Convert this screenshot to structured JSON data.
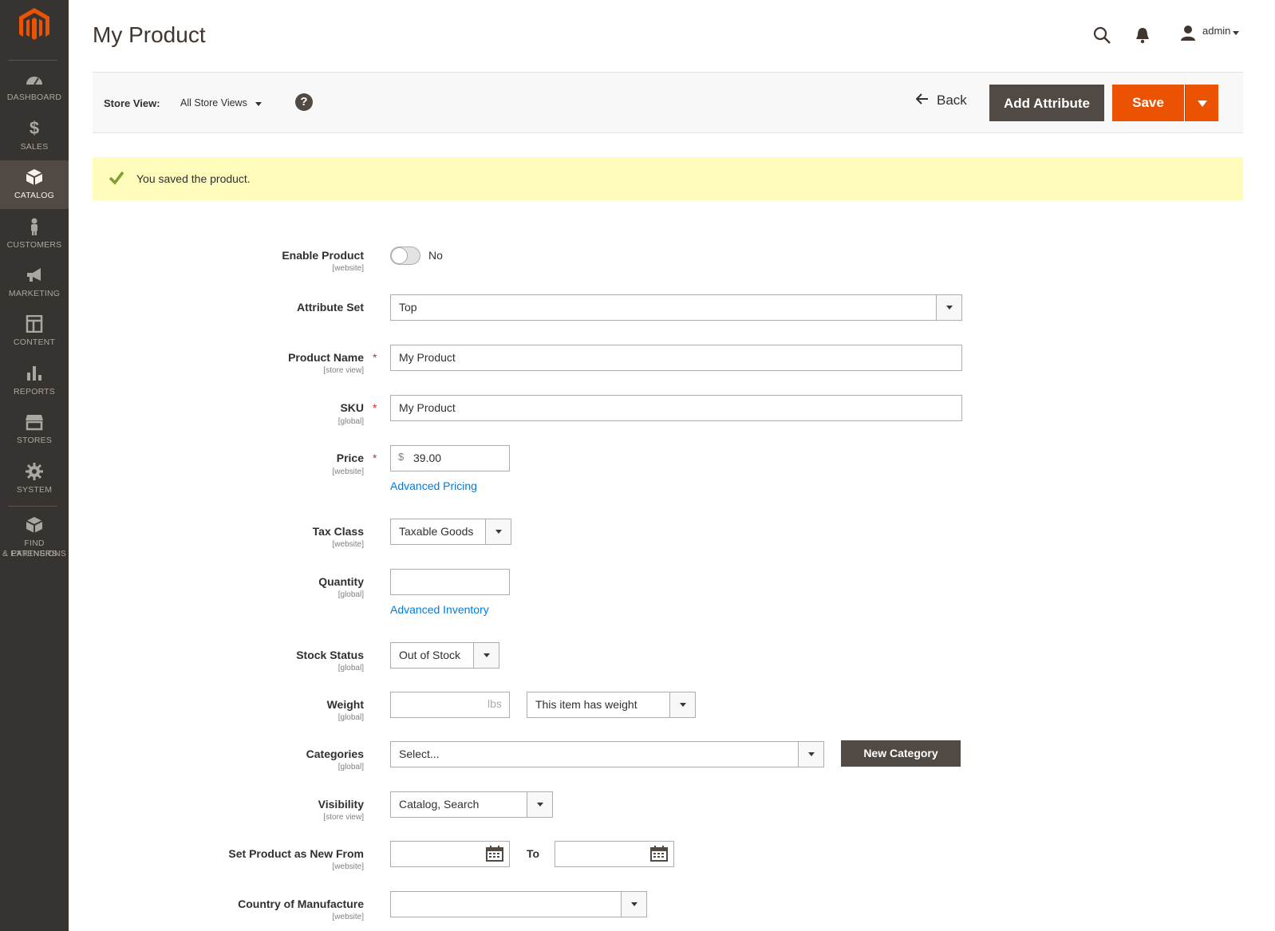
{
  "sidebar": {
    "items": [
      {
        "label": "Dashboard",
        "icon": "dashboard-icon"
      },
      {
        "label": "$",
        "icon": "dollar-icon"
      },
      {
        "label": "Sales",
        "icon": "sales-icon"
      },
      {
        "label": "Catalog",
        "icon": "catalog-icon"
      },
      {
        "label": "Customers",
        "icon": "customers-icon"
      },
      {
        "label": "Marketing",
        "icon": "marketing-icon"
      },
      {
        "label": "Content",
        "icon": "content-icon"
      },
      {
        "label": "Reports",
        "icon": "reports-icon"
      },
      {
        "label": "Stores",
        "icon": "stores-icon"
      },
      {
        "label": "System",
        "icon": "system-icon"
      },
      {
        "label": "Find Partners",
        "icon": "partners-icon"
      },
      {
        "label": "& Extensions"
      }
    ],
    "active": "Catalog",
    "colors": {
      "bg": "#373330",
      "active_bg": "#514943",
      "logo": "#eb5202"
    }
  },
  "header": {
    "title": "My Product",
    "user": "admin"
  },
  "toolbar": {
    "store_view_label": "Store View:",
    "store_view_value": "All Store Views",
    "help": "?",
    "back_label": "Back",
    "add_attribute_label": "Add Attribute",
    "save_label": "Save"
  },
  "message": {
    "text": "You saved the product.",
    "color": "#fffbbb"
  },
  "form": {
    "enable_product": {
      "label": "Enable Product",
      "scope": "[website]",
      "value": "No"
    },
    "attribute_set": {
      "label": "Attribute Set",
      "value": "Top"
    },
    "product_name": {
      "label": "Product Name",
      "scope": "[store view]",
      "value": "My Product",
      "required": "*"
    },
    "sku": {
      "label": "SKU",
      "scope": "[global]",
      "value": "My Product",
      "required": "*"
    },
    "price": {
      "label": "Price",
      "scope": "[website]",
      "currency": "$",
      "value": "39.00",
      "required": "*",
      "link": "Advanced Pricing"
    },
    "tax_class": {
      "label": "Tax Class",
      "scope": "[website]",
      "value": "Taxable Goods"
    },
    "quantity": {
      "label": "Quantity",
      "scope": "[global]",
      "value": "",
      "link": "Advanced Inventory"
    },
    "stock_status": {
      "label": "Stock Status",
      "scope": "[global]",
      "value": "Out of Stock"
    },
    "weight": {
      "label": "Weight",
      "scope": "[global]",
      "unit": "lbs",
      "value": "",
      "has_weight": "This item has weight"
    },
    "categories": {
      "label": "Categories",
      "scope": "[global]",
      "value": "Select...",
      "new_category": "New Category"
    },
    "visibility": {
      "label": "Visibility",
      "scope": "[store view]",
      "value": "Catalog, Search"
    },
    "new_from": {
      "label": "Set Product as New From",
      "scope": "[website]",
      "to_label": "To"
    },
    "country": {
      "label": "Country of Manufacture",
      "scope": "[website]",
      "value": ""
    }
  },
  "colors": {
    "accent": "#eb5202",
    "dark_button": "#514943",
    "link": "#007bdb",
    "required": "#e22626"
  }
}
